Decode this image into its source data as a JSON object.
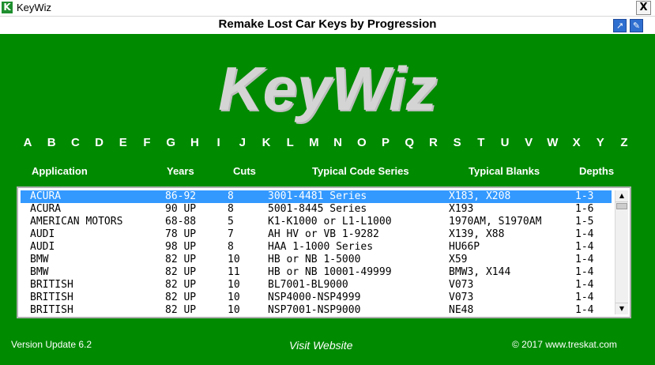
{
  "window": {
    "title": "KeyWiz",
    "icon_letter": "K",
    "close_label": "X"
  },
  "header": {
    "subtitle": "Remake Lost Car Keys by Progression",
    "popout_icon": "external-link-icon",
    "edit_icon": "edit-icon"
  },
  "logo": {
    "text": "KeyWiz"
  },
  "alphabet": [
    "A",
    "B",
    "C",
    "D",
    "E",
    "F",
    "G",
    "H",
    "I",
    "J",
    "K",
    "L",
    "M",
    "N",
    "O",
    "P",
    "Q",
    "R",
    "S",
    "T",
    "U",
    "V",
    "W",
    "X",
    "Y",
    "Z"
  ],
  "columns": {
    "application": "Application",
    "years": "Years",
    "cuts": "Cuts",
    "code_series": "Typical Code Series",
    "blanks": "Typical Blanks",
    "depths": "Depths"
  },
  "rows": [
    {
      "app": "ACURA",
      "years": "86-92",
      "cuts": "8",
      "code": "3001-4481 Series",
      "blank": "X183, X208",
      "depth": "1-3",
      "selected": true
    },
    {
      "app": "ACURA",
      "years": "90 UP",
      "cuts": "8",
      "code": "5001-8445 Series",
      "blank": "X193",
      "depth": "1-6"
    },
    {
      "app": "AMERICAN MOTORS",
      "years": "68-88",
      "cuts": "5",
      "code": "K1-K1000 or L1-L1000",
      "blank": "1970AM, S1970AM",
      "depth": "1-5"
    },
    {
      "app": "AUDI",
      "years": "78 UP",
      "cuts": "7",
      "code": "AH HV or VB 1-9282",
      "blank": "X139, X88",
      "depth": "1-4"
    },
    {
      "app": "AUDI",
      "years": "98 UP",
      "cuts": "8",
      "code": "HAA 1-1000 Series",
      "blank": "HU66P",
      "depth": "1-4"
    },
    {
      "app": "BMW",
      "years": "82 UP",
      "cuts": "10",
      "code": "HB or NB 1-5000",
      "blank": "X59",
      "depth": "1-4"
    },
    {
      "app": "BMW",
      "years": "82 UP",
      "cuts": "11",
      "code": "HB or NB 10001-49999",
      "blank": "BMW3, X144",
      "depth": "1-4"
    },
    {
      "app": "BRITISH",
      "years": "82 UP",
      "cuts": "10",
      "code": "BL7001-BL9000",
      "blank": "V073",
      "depth": "1-4"
    },
    {
      "app": "BRITISH",
      "years": "82 UP",
      "cuts": "10",
      "code": "NSP4000-NSP4999",
      "blank": "V073",
      "depth": "1-4"
    },
    {
      "app": "BRITISH",
      "years": "82 UP",
      "cuts": "10",
      "code": "NSP7001-NSP9000",
      "blank": "NE48",
      "depth": "1-4"
    }
  ],
  "footer": {
    "version": "Version Update 6.2",
    "visit": "Visit Website",
    "copyright": "© 2017 www.treskat.com"
  },
  "colors": {
    "main_bg": "#008a00",
    "selection": "#3399ff",
    "logo": "#d4d4d4"
  }
}
